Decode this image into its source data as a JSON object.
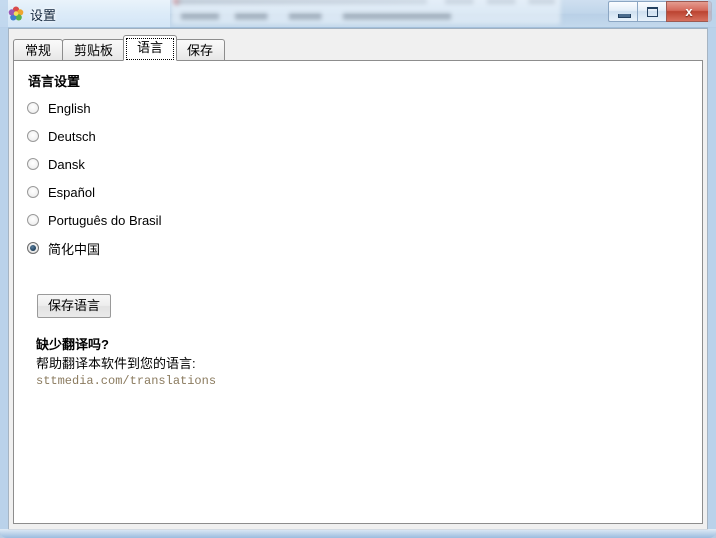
{
  "window": {
    "title": "设置",
    "icon": "flower-pinwheel-icon",
    "controls": {
      "minimize": "—",
      "maximize": "❐",
      "close": "x"
    }
  },
  "tabs": [
    {
      "label": "常规",
      "name": "tab-general",
      "active": false
    },
    {
      "label": "剪贴板",
      "name": "tab-clipboard",
      "active": false
    },
    {
      "label": "语言",
      "name": "tab-language",
      "active": true
    },
    {
      "label": "保存",
      "name": "tab-save",
      "active": false
    }
  ],
  "language_page": {
    "section_title": "语言设置",
    "options": [
      {
        "label": "English",
        "selected": false
      },
      {
        "label": "Deutsch",
        "selected": false
      },
      {
        "label": "Dansk",
        "selected": false
      },
      {
        "label": "Español",
        "selected": false
      },
      {
        "label": "Português do Brasil",
        "selected": false
      },
      {
        "label": "简化中国",
        "selected": true
      }
    ],
    "save_button": "保存语言",
    "missing_title": "缺少翻译吗?",
    "missing_subtitle": "帮助翻译本软件到您的语言:",
    "translate_link": "sttmedia.com/translations"
  },
  "colors": {
    "accent": "#1d3f5c",
    "link": "#8a7a5e",
    "close_button": "#bb4330",
    "client_background": "#f0f0f0",
    "panel_background": "#ffffff"
  }
}
